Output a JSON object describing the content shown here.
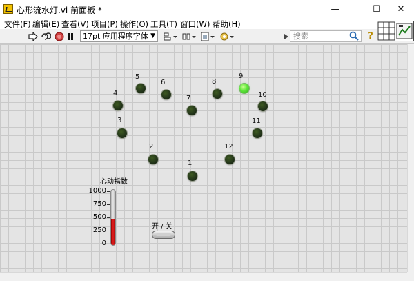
{
  "window": {
    "title": "心形流水灯.vi 前面板 *",
    "minimize": "—",
    "maximize": "☐",
    "close": "✕"
  },
  "menu": [
    "文件(F)",
    "编辑(E)",
    "查看(V)",
    "项目(P)",
    "操作(O)",
    "工具(T)",
    "窗口(W)",
    "帮助(H)"
  ],
  "toolbar": {
    "font": "17pt 应用程序字体",
    "search_placeholder": "搜索",
    "help": "?"
  },
  "panel": {
    "leds": [
      {
        "label": "1",
        "on": false
      },
      {
        "label": "2",
        "on": false
      },
      {
        "label": "3",
        "on": false
      },
      {
        "label": "4",
        "on": false
      },
      {
        "label": "5",
        "on": false
      },
      {
        "label": "6",
        "on": false
      },
      {
        "label": "7",
        "on": false
      },
      {
        "label": "8",
        "on": false
      },
      {
        "label": "9",
        "on": true
      },
      {
        "label": "10",
        "on": false
      },
      {
        "label": "11",
        "on": false
      },
      {
        "label": "12",
        "on": false
      }
    ],
    "gauge": {
      "title": "心动指数",
      "ticks": [
        "1000",
        "750",
        "500",
        "250",
        "0"
      ],
      "min": 0,
      "max": 1000,
      "value": 480
    },
    "switch": {
      "label": "开 / 关",
      "state": "off"
    }
  }
}
